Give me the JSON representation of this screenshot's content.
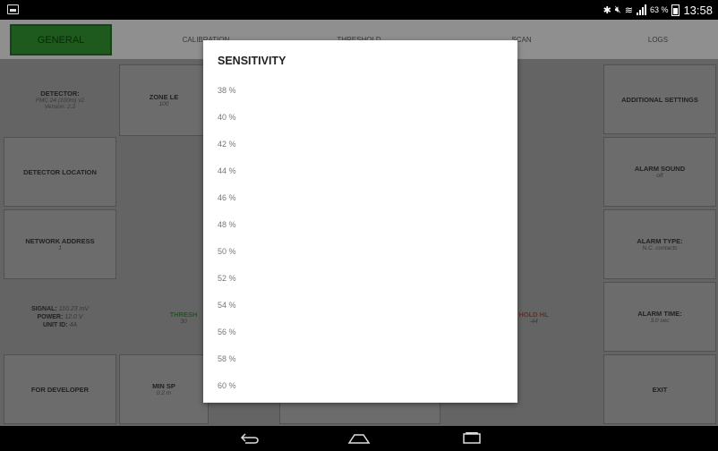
{
  "status_bar": {
    "battery_percent": "63 %",
    "time": "13:58",
    "icons": [
      "bluetooth-icon",
      "mute-icon",
      "wifi-icon",
      "signal-icon",
      "battery-icon"
    ]
  },
  "tabs": [
    {
      "label": "GENERAL",
      "active": true
    },
    {
      "label": "CALIBRATION",
      "active": false
    },
    {
      "label": "THRESHOLD",
      "active": false
    },
    {
      "label": "SCAN",
      "active": false
    },
    {
      "label": "LOGS",
      "active": false
    }
  ],
  "left_panel": {
    "detector_title": "DETECTOR:",
    "detector_model": "FMC 24 (100m) v2",
    "detector_version": "Version: 2.2",
    "location_label": "DETECTOR LOCATION",
    "network_label": "NETWORK ADDRESS",
    "network_value": "1",
    "signal_label": "SIGNAL:",
    "signal_value": "110.23 mV",
    "power_label": "POWER:",
    "power_value": "12.0 V",
    "unit_label": "UNIT ID:",
    "unit_value": "4A",
    "developer_label": "FOR DEVELOPER"
  },
  "middle_panel": {
    "zone_label": "ZONE LE",
    "zone_value": "100",
    "threshold_label": "THRESH",
    "threshold_value": "30",
    "threshold_hl_label": "HOLD HL",
    "threshold_hl_value": "-44",
    "min_label": "MIN SP",
    "min_value": "0.2 m"
  },
  "right_panel": {
    "additional_label": "ADDITIONAL SETTINGS",
    "alarm_sound_label": "ALARM SOUND",
    "alarm_sound_value": "off",
    "alarm_type_label": "ALARM TYPE:",
    "alarm_type_value": "N.C. contacts",
    "alarm_time_label": "ALARM TIME:",
    "alarm_time_value": "3.0 sec",
    "exit_label": "EXIT"
  },
  "dialog": {
    "title": "SENSITIVITY",
    "options": [
      "38 %",
      "40 %",
      "42 %",
      "44 %",
      "46 %",
      "48 %",
      "50 %",
      "52 %",
      "54 %",
      "56 %",
      "58 %",
      "60 %"
    ]
  },
  "nav": {
    "icons": [
      "back-icon",
      "home-icon",
      "recent-apps-icon"
    ]
  },
  "colors": {
    "active_tab": "#2e8b2e",
    "threshold_green": "#2e8b2e",
    "threshold_red": "#c0392b"
  }
}
